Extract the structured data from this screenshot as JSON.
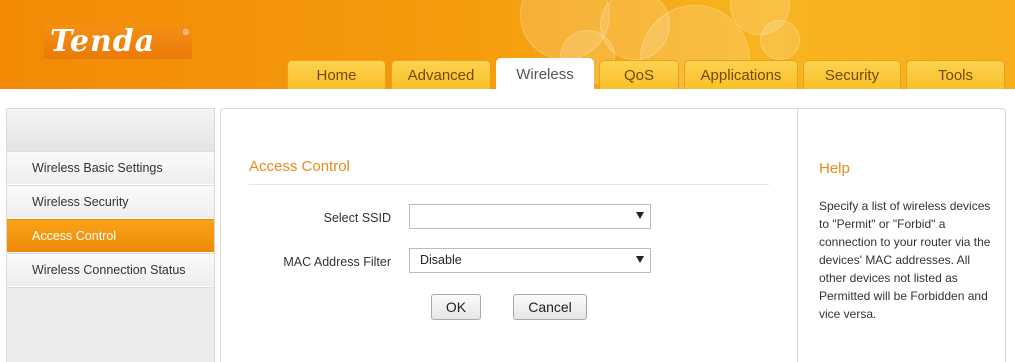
{
  "header": {
    "logo_text": "Tenda",
    "logo_mark": "®",
    "tabs": [
      {
        "label": "Home"
      },
      {
        "label": "Advanced"
      },
      {
        "label": "Wireless"
      },
      {
        "label": "QoS"
      },
      {
        "label": "Applications"
      },
      {
        "label": "Security"
      },
      {
        "label": "Tools"
      }
    ],
    "active_tab": "Wireless"
  },
  "sidebar": {
    "items": [
      {
        "label": "Wireless Basic Settings"
      },
      {
        "label": "Wireless Security"
      },
      {
        "label": "Access Control"
      },
      {
        "label": "Wireless Connection Status"
      }
    ],
    "active_item": "Access Control"
  },
  "main": {
    "section_title": "Access Control",
    "select_ssid": {
      "label": "Select SSID",
      "value": ""
    },
    "mac_filter": {
      "label": "MAC Address Filter",
      "value": "Disable"
    },
    "ok_label": "OK",
    "cancel_label": "Cancel"
  },
  "help": {
    "title": "Help",
    "text": "Specify a list of wireless devices to \"Permit\" or \"Forbid\" a connection to your router via the devices' MAC addresses. All other devices not listed as Permitted will be Forbidden and vice versa."
  },
  "colors": {
    "brand_orange": "#f28a06",
    "tab_yellow": "#fcd24f",
    "accent_text": "#e98a1a"
  }
}
